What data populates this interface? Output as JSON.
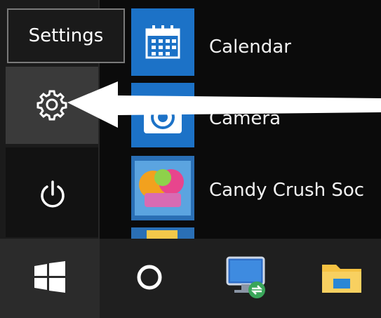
{
  "tooltip": {
    "text": "Settings"
  },
  "left_rail": [
    {
      "name": "settings",
      "icon": "gear-icon"
    },
    {
      "name": "power",
      "icon": "power-icon"
    }
  ],
  "apps": [
    {
      "label": "Calendar",
      "icon": "calendar-icon"
    },
    {
      "label": "Camera",
      "icon": "camera-icon"
    },
    {
      "label": "Candy Crush Soc",
      "icon": "candy-crush-icon"
    }
  ],
  "taskbar": [
    {
      "name": "start",
      "icon": "windows-logo-icon"
    },
    {
      "name": "search",
      "icon": "cortana-circle-icon"
    },
    {
      "name": "remote-desktop",
      "icon": "remote-desktop-icon"
    },
    {
      "name": "file-explorer",
      "icon": "folder-icon"
    }
  ],
  "colors": {
    "tile_blue": "#1c72c7",
    "settings_highlight": "#3a3a3a",
    "taskbar": "#1f1f1f",
    "arrow": "#ffffff"
  }
}
